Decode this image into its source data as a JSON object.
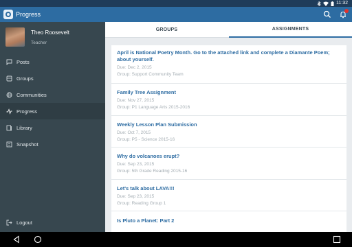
{
  "status": {
    "time": "11:32"
  },
  "app": {
    "title": "Progress"
  },
  "profile": {
    "name": "Theo Roosevelt",
    "role": "Teacher"
  },
  "nav": [
    {
      "label": "Posts",
      "icon": "posts-icon"
    },
    {
      "label": "Groups",
      "icon": "groups-icon"
    },
    {
      "label": "Communities",
      "icon": "communities-icon"
    },
    {
      "label": "Progress",
      "icon": "progress-icon",
      "active": true
    },
    {
      "label": "Library",
      "icon": "library-icon"
    },
    {
      "label": "Snapshot",
      "icon": "snapshot-icon"
    }
  ],
  "logout": {
    "label": "Logout"
  },
  "tabs": [
    {
      "label": "GROUPS"
    },
    {
      "label": "ASSIGNMENTS",
      "active": true
    }
  ],
  "assignments": [
    {
      "title": "April is National Poetry Month.  Go to the attached link and complete a Diamante Poem; about yourself.",
      "due": "Due: Dec 2, 2015",
      "group": "Group: Support Community Team"
    },
    {
      "title": "Family Tree Assignment",
      "due": "Due: Nov 27, 2015",
      "group": "Group: P1 Language Arts 2015-2016"
    },
    {
      "title": "Weekly Lesson Plan Submission",
      "due": "Due: Oct 7, 2015",
      "group": "Group: P5 - Science 2015-16"
    },
    {
      "title": "Why do volcanoes erupt?",
      "due": "Due: Sep 23, 2015",
      "group": "Group: 5th Grade Reading 2015-16"
    },
    {
      "title": "Let's talk about LAVA!!!",
      "due": "Due: Sep 23, 2015",
      "group": "Group: Reading Group 1"
    },
    {
      "title": "Is Pluto a Planet: Part 2",
      "due": "",
      "group": ""
    }
  ],
  "colors": {
    "appbar": "#2d6ca2",
    "sidebar": "#37474f",
    "accent": "#2d6ca2",
    "badge": "#e4322b"
  }
}
